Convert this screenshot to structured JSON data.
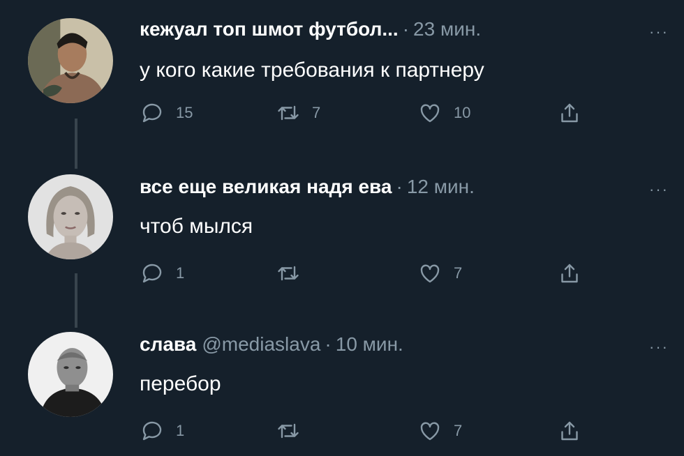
{
  "tweets": [
    {
      "name": "кежуал топ шмот футбол...",
      "handle": "",
      "separator": "·",
      "time": "23 мин.",
      "more": "···",
      "text": "у кого какие требования к партнеру",
      "replies": "15",
      "retweets": "7",
      "likes": "10"
    },
    {
      "name": "все еще великая надя ева",
      "handle": "",
      "separator": "·",
      "time": "12 мин.",
      "more": "···",
      "text": "чтоб мылся",
      "replies": "1",
      "retweets": "",
      "likes": "7"
    },
    {
      "name": "слава",
      "handle": "@mediaslava",
      "separator": "·",
      "time": "10 мин.",
      "more": "···",
      "text": "перебор",
      "replies": "1",
      "retweets": "",
      "likes": "7"
    }
  ],
  "icons": {
    "reply": "reply-icon",
    "retweet": "retweet-icon",
    "like": "heart-icon",
    "share": "share-icon",
    "more": "more-icon"
  },
  "colors": {
    "background": "#15202b",
    "text": "#ffffff",
    "secondary": "#8899a6",
    "thread_line": "#38444d"
  }
}
